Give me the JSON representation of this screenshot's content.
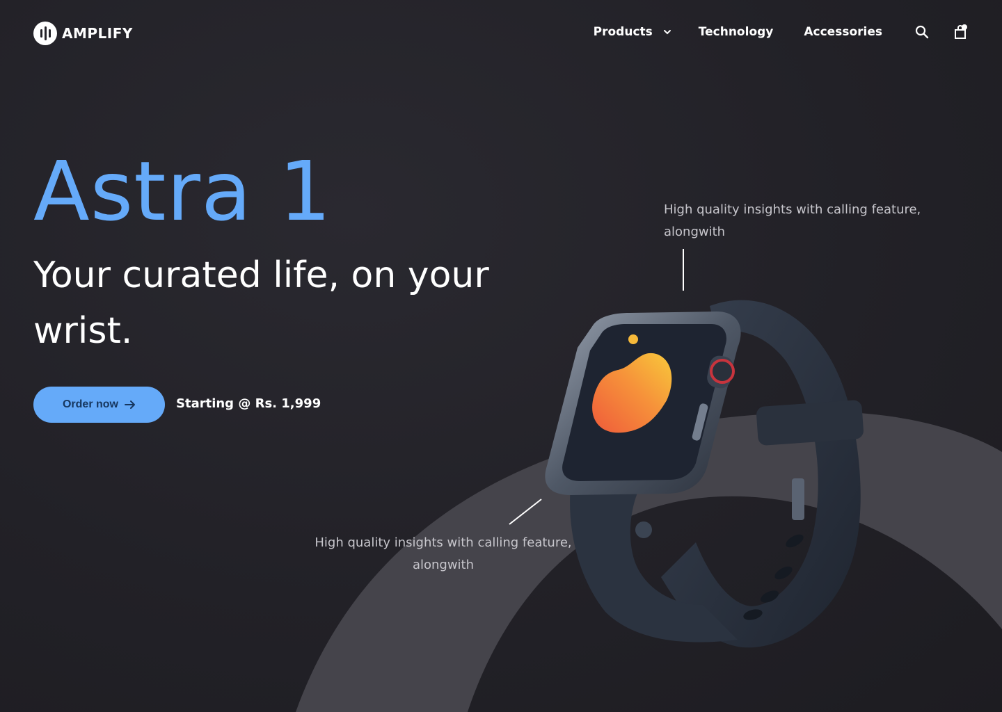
{
  "brand": {
    "name": "AMPLIFY"
  },
  "nav": {
    "items": [
      {
        "label": "Products",
        "has_dropdown": true
      },
      {
        "label": "Technology"
      },
      {
        "label": "Accessories"
      }
    ],
    "search_icon": "search-icon",
    "cart_icon": "shopping-bag-icon",
    "cart_has_badge": true
  },
  "hero": {
    "title": "Astra 1",
    "tagline": "Your curated life, on your wrist.",
    "cta_label": "Order now",
    "price_text": "Starting @ Rs. 1,999"
  },
  "callouts": {
    "top": "High quality insights with calling feature, alongwith",
    "bottom": "High quality insights with calling feature, alongwith"
  },
  "colors": {
    "accent": "#65aaf9",
    "background": "#232228",
    "arc": "#45444b",
    "text": "#ffffff",
    "muted_text": "#c7c6cc"
  }
}
